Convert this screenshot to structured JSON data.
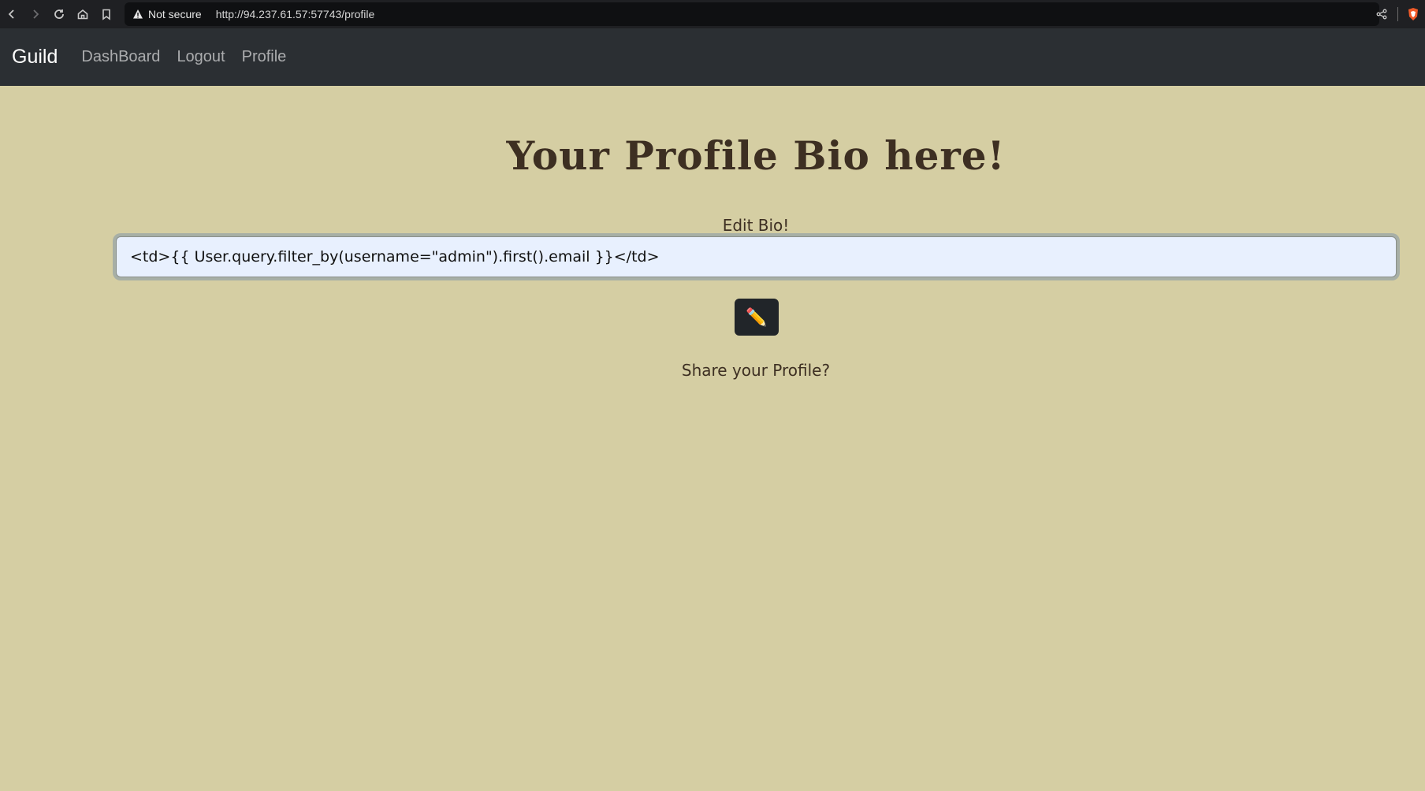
{
  "browser": {
    "security_label": "Not secure",
    "url": "http://94.237.61.57:57743/profile"
  },
  "navbar": {
    "brand": "Guild",
    "links": [
      "DashBoard",
      "Logout",
      "Profile"
    ]
  },
  "main": {
    "title": "Your Profile Bio here!",
    "edit_label": "Edit Bio!",
    "bio_value": "<td>{{ User.query.filter_by(username=\"admin\").first().email }}</td>",
    "edit_button_icon": "pencil-icon",
    "edit_button_glyph": "✏️",
    "share_text": "Share your Profile?"
  },
  "colors": {
    "page_bg": "#d5cea3",
    "navbar_bg": "#2b2f33",
    "text_brown": "#3d2f22",
    "button_dark": "#212529"
  }
}
